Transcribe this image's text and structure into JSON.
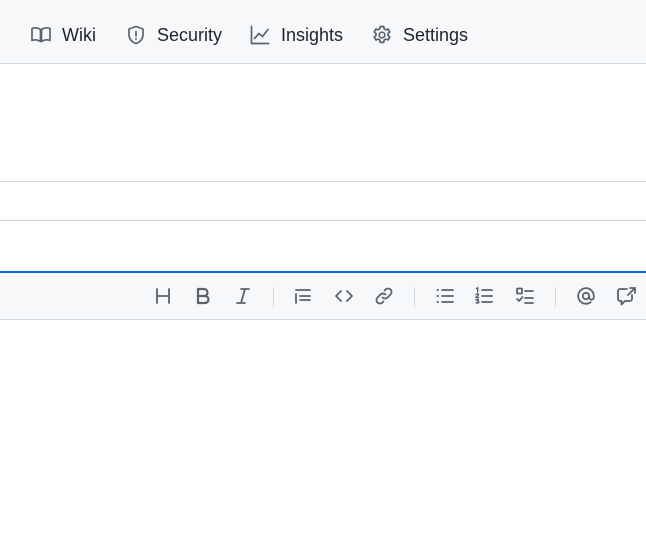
{
  "repo_nav": {
    "items": [
      {
        "label": "Wiki",
        "icon": "book-icon"
      },
      {
        "label": "Security",
        "icon": "shield-icon"
      },
      {
        "label": "Insights",
        "icon": "graph-icon"
      },
      {
        "label": "Settings",
        "icon": "gear-icon"
      }
    ]
  },
  "toolbar": {
    "buttons": [
      "heading-icon",
      "bold-icon",
      "italic-icon",
      "quote-icon",
      "code-icon",
      "link-icon",
      "unordered-list-icon",
      "ordered-list-icon",
      "task-list-icon",
      "mention-icon",
      "reference-icon"
    ]
  },
  "colors": {
    "nav_background": "#f6f8fa",
    "border": "#d0d7de",
    "focus_accent": "#0969da",
    "icon": "#59636e",
    "text": "#1f2328"
  }
}
